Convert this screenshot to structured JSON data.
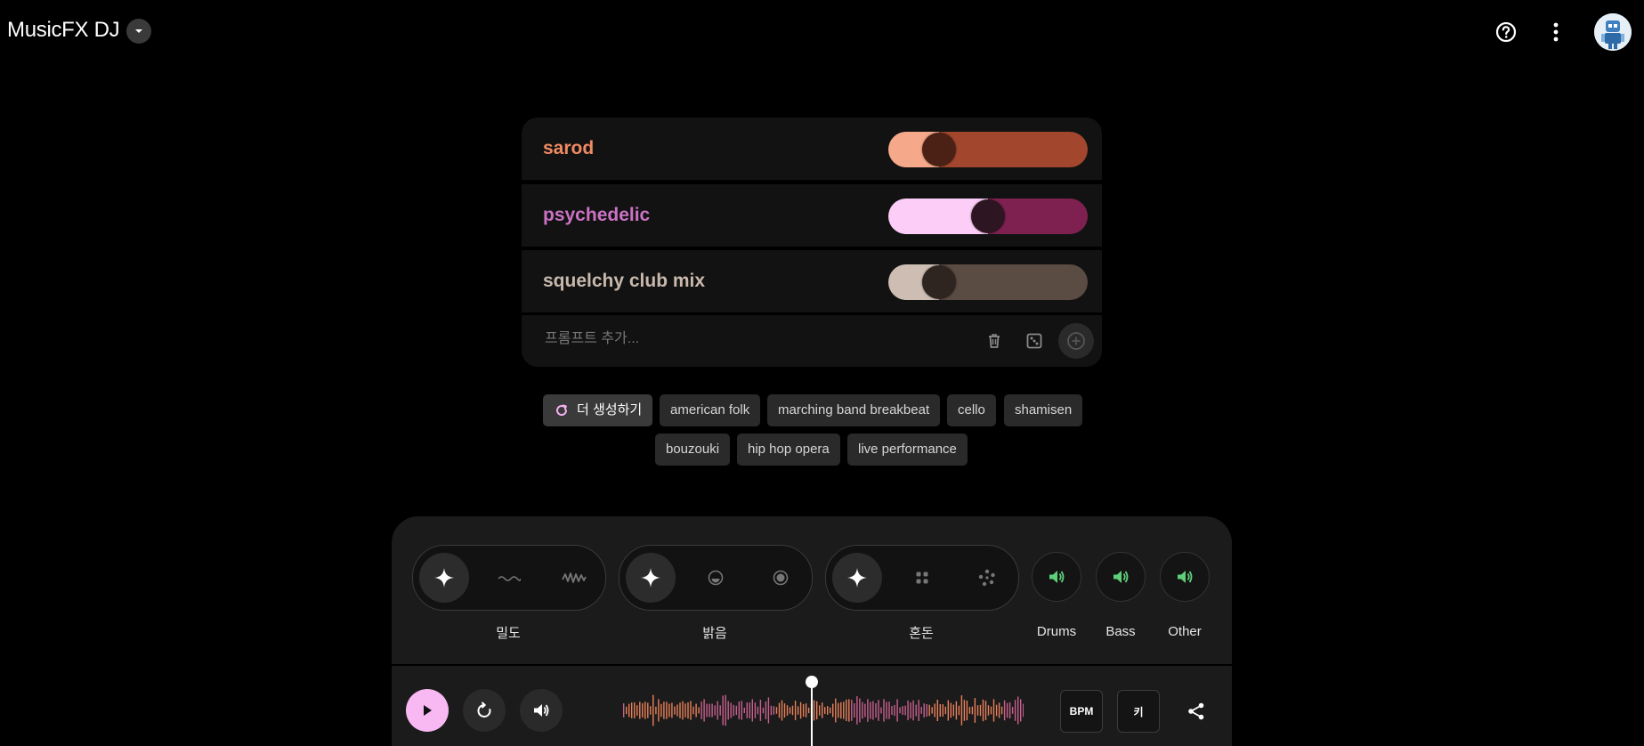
{
  "header": {
    "title": "MusicFX DJ",
    "icons": [
      "chevron-down-icon",
      "help-icon",
      "more-vert-icon",
      "avatar"
    ]
  },
  "prompts": [
    {
      "label": "sarod",
      "color": "#f08a63",
      "weight": 0.2,
      "fill_color": "#f6a98a",
      "track_color": "#a2472d",
      "thumb_color": "#4b2116"
    },
    {
      "label": "psychedelic",
      "color": "#cc72c4",
      "weight": 0.5,
      "fill_color": "#fccdf7",
      "track_color": "#7f2150",
      "thumb_color": "#2d1521"
    },
    {
      "label": "squelchy club mix",
      "color": "#c9b9ad",
      "weight": 0.2,
      "fill_color": "#cdbdb3",
      "track_color": "#5a4b43",
      "thumb_color": "#2f2520"
    }
  ],
  "add_prompt": {
    "placeholder": "프롬프트 추가..."
  },
  "suggestions": {
    "generate_label": "더 생성하기",
    "chips": [
      "american folk",
      "marching band breakbeat",
      "cello",
      "shamisen",
      "bouzouki",
      "hip hop opera",
      "live performance"
    ]
  },
  "controls": {
    "density_label": "밀도",
    "brightness_label": "밝음",
    "chaos_label": "혼돈",
    "stems": [
      "Drums",
      "Bass",
      "Other"
    ]
  },
  "player": {
    "bpm_label": "BPM",
    "key_label": "키",
    "progress": 0.5
  },
  "colors": {
    "stem_active": "#5fcf7a",
    "play_button": "#f8b8f2",
    "wave_pink": "#c8608f",
    "wave_orange": "#e8805a"
  }
}
